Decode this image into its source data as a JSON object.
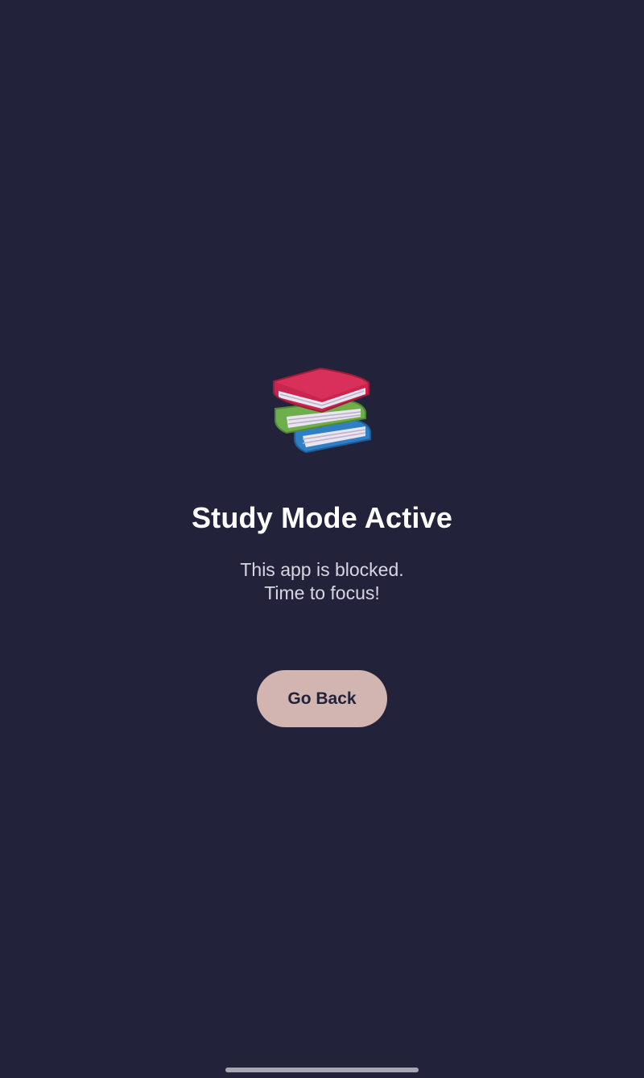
{
  "block_screen": {
    "icon": "books-stack-icon",
    "title": "Study Mode Active",
    "message_line1": "This app is blocked.",
    "message_line2": "Time to focus!",
    "go_back_label": "Go Back"
  },
  "colors": {
    "background": "#23223b",
    "title": "#ffffff",
    "message": "#d9d6e2",
    "button_bg": "#d2b5b0",
    "button_text": "#23223b",
    "home_indicator": "#a7a6b4"
  }
}
